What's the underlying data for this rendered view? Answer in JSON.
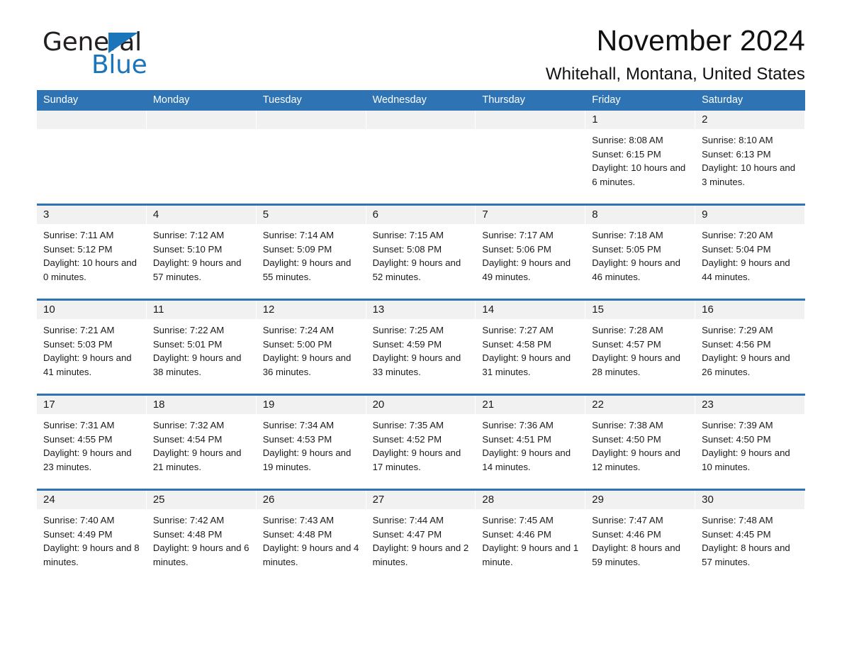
{
  "brand": {
    "name_part1": "General",
    "name_part2": "Blue"
  },
  "header": {
    "title": "November 2024",
    "location": "Whitehall, Montana, United States"
  },
  "calendar": {
    "weekdays": [
      "Sunday",
      "Monday",
      "Tuesday",
      "Wednesday",
      "Thursday",
      "Friday",
      "Saturday"
    ],
    "accent_color": "#2e74b5",
    "daynum_band_color": "#f1f1f1",
    "labels": {
      "sunrise": "Sunrise:",
      "sunset": "Sunset:",
      "daylight": "Daylight:"
    },
    "weeks": [
      [
        {
          "day": "",
          "empty": true
        },
        {
          "day": "",
          "empty": true
        },
        {
          "day": "",
          "empty": true
        },
        {
          "day": "",
          "empty": true
        },
        {
          "day": "",
          "empty": true
        },
        {
          "day": "1",
          "sunrise": "Sunrise: 8:08 AM",
          "sunset": "Sunset: 6:15 PM",
          "daylight": "Daylight: 10 hours and 6 minutes."
        },
        {
          "day": "2",
          "sunrise": "Sunrise: 8:10 AM",
          "sunset": "Sunset: 6:13 PM",
          "daylight": "Daylight: 10 hours and 3 minutes."
        }
      ],
      [
        {
          "day": "3",
          "sunrise": "Sunrise: 7:11 AM",
          "sunset": "Sunset: 5:12 PM",
          "daylight": "Daylight: 10 hours and 0 minutes."
        },
        {
          "day": "4",
          "sunrise": "Sunrise: 7:12 AM",
          "sunset": "Sunset: 5:10 PM",
          "daylight": "Daylight: 9 hours and 57 minutes."
        },
        {
          "day": "5",
          "sunrise": "Sunrise: 7:14 AM",
          "sunset": "Sunset: 5:09 PM",
          "daylight": "Daylight: 9 hours and 55 minutes."
        },
        {
          "day": "6",
          "sunrise": "Sunrise: 7:15 AM",
          "sunset": "Sunset: 5:08 PM",
          "daylight": "Daylight: 9 hours and 52 minutes."
        },
        {
          "day": "7",
          "sunrise": "Sunrise: 7:17 AM",
          "sunset": "Sunset: 5:06 PM",
          "daylight": "Daylight: 9 hours and 49 minutes."
        },
        {
          "day": "8",
          "sunrise": "Sunrise: 7:18 AM",
          "sunset": "Sunset: 5:05 PM",
          "daylight": "Daylight: 9 hours and 46 minutes."
        },
        {
          "day": "9",
          "sunrise": "Sunrise: 7:20 AM",
          "sunset": "Sunset: 5:04 PM",
          "daylight": "Daylight: 9 hours and 44 minutes."
        }
      ],
      [
        {
          "day": "10",
          "sunrise": "Sunrise: 7:21 AM",
          "sunset": "Sunset: 5:03 PM",
          "daylight": "Daylight: 9 hours and 41 minutes."
        },
        {
          "day": "11",
          "sunrise": "Sunrise: 7:22 AM",
          "sunset": "Sunset: 5:01 PM",
          "daylight": "Daylight: 9 hours and 38 minutes."
        },
        {
          "day": "12",
          "sunrise": "Sunrise: 7:24 AM",
          "sunset": "Sunset: 5:00 PM",
          "daylight": "Daylight: 9 hours and 36 minutes."
        },
        {
          "day": "13",
          "sunrise": "Sunrise: 7:25 AM",
          "sunset": "Sunset: 4:59 PM",
          "daylight": "Daylight: 9 hours and 33 minutes."
        },
        {
          "day": "14",
          "sunrise": "Sunrise: 7:27 AM",
          "sunset": "Sunset: 4:58 PM",
          "daylight": "Daylight: 9 hours and 31 minutes."
        },
        {
          "day": "15",
          "sunrise": "Sunrise: 7:28 AM",
          "sunset": "Sunset: 4:57 PM",
          "daylight": "Daylight: 9 hours and 28 minutes."
        },
        {
          "day": "16",
          "sunrise": "Sunrise: 7:29 AM",
          "sunset": "Sunset: 4:56 PM",
          "daylight": "Daylight: 9 hours and 26 minutes."
        }
      ],
      [
        {
          "day": "17",
          "sunrise": "Sunrise: 7:31 AM",
          "sunset": "Sunset: 4:55 PM",
          "daylight": "Daylight: 9 hours and 23 minutes."
        },
        {
          "day": "18",
          "sunrise": "Sunrise: 7:32 AM",
          "sunset": "Sunset: 4:54 PM",
          "daylight": "Daylight: 9 hours and 21 minutes."
        },
        {
          "day": "19",
          "sunrise": "Sunrise: 7:34 AM",
          "sunset": "Sunset: 4:53 PM",
          "daylight": "Daylight: 9 hours and 19 minutes."
        },
        {
          "day": "20",
          "sunrise": "Sunrise: 7:35 AM",
          "sunset": "Sunset: 4:52 PM",
          "daylight": "Daylight: 9 hours and 17 minutes."
        },
        {
          "day": "21",
          "sunrise": "Sunrise: 7:36 AM",
          "sunset": "Sunset: 4:51 PM",
          "daylight": "Daylight: 9 hours and 14 minutes."
        },
        {
          "day": "22",
          "sunrise": "Sunrise: 7:38 AM",
          "sunset": "Sunset: 4:50 PM",
          "daylight": "Daylight: 9 hours and 12 minutes."
        },
        {
          "day": "23",
          "sunrise": "Sunrise: 7:39 AM",
          "sunset": "Sunset: 4:50 PM",
          "daylight": "Daylight: 9 hours and 10 minutes."
        }
      ],
      [
        {
          "day": "24",
          "sunrise": "Sunrise: 7:40 AM",
          "sunset": "Sunset: 4:49 PM",
          "daylight": "Daylight: 9 hours and 8 minutes."
        },
        {
          "day": "25",
          "sunrise": "Sunrise: 7:42 AM",
          "sunset": "Sunset: 4:48 PM",
          "daylight": "Daylight: 9 hours and 6 minutes."
        },
        {
          "day": "26",
          "sunrise": "Sunrise: 7:43 AM",
          "sunset": "Sunset: 4:48 PM",
          "daylight": "Daylight: 9 hours and 4 minutes."
        },
        {
          "day": "27",
          "sunrise": "Sunrise: 7:44 AM",
          "sunset": "Sunset: 4:47 PM",
          "daylight": "Daylight: 9 hours and 2 minutes."
        },
        {
          "day": "28",
          "sunrise": "Sunrise: 7:45 AM",
          "sunset": "Sunset: 4:46 PM",
          "daylight": "Daylight: 9 hours and 1 minute."
        },
        {
          "day": "29",
          "sunrise": "Sunrise: 7:47 AM",
          "sunset": "Sunset: 4:46 PM",
          "daylight": "Daylight: 8 hours and 59 minutes."
        },
        {
          "day": "30",
          "sunrise": "Sunrise: 7:48 AM",
          "sunset": "Sunset: 4:45 PM",
          "daylight": "Daylight: 8 hours and 57 minutes."
        }
      ]
    ]
  }
}
